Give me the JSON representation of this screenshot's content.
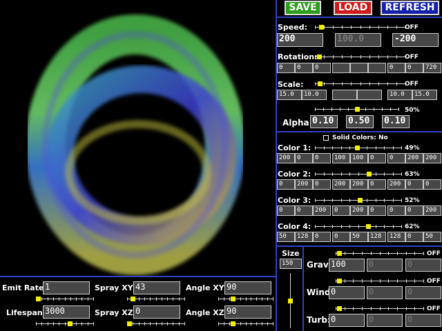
{
  "toolbar": {
    "save_label": "SAVE",
    "load_label": "LOAD",
    "refresh_label": "REFRESH",
    "save_color": "#2a9d1a",
    "load_color": "#cf1a1a",
    "refresh_color": "#1420aa"
  },
  "speed": {
    "label": "Speed:",
    "state": "OFF",
    "level": 0.05,
    "values": [
      "200",
      "100.0",
      "-200"
    ]
  },
  "rotation": {
    "label": "Rotation:",
    "state": "OFF",
    "level": 0.02,
    "values": [
      "0",
      "0",
      "0",
      "",
      "",
      "",
      "0",
      "0",
      "720"
    ]
  },
  "scale": {
    "label": "Scale:",
    "state": "OFF",
    "level": 0.03,
    "values": [
      "15.0",
      "10.0",
      "",
      "",
      "10.0",
      "15.0"
    ]
  },
  "alpha": {
    "label": "Alpha:",
    "percent": "50%",
    "level": 0.5,
    "values": [
      "0.10",
      "0.50",
      "0.10"
    ]
  },
  "solid_colors": {
    "label": "Solid Colors: No"
  },
  "colors": [
    {
      "label": "Color 1:",
      "percent": "49%",
      "level": 0.49,
      "values": [
        "200",
        "0",
        "0",
        "100",
        "100",
        "0",
        "0",
        "200",
        "200"
      ]
    },
    {
      "label": "Color 2:",
      "percent": "63%",
      "level": 0.63,
      "values": [
        "0",
        "200",
        "0",
        "200",
        "200",
        "0",
        "200",
        "0",
        "0"
      ]
    },
    {
      "label": "Color 3:",
      "percent": "52%",
      "level": 0.52,
      "values": [
        "0",
        "0",
        "200",
        "0",
        "200",
        "0",
        "0",
        "0",
        "200"
      ]
    },
    {
      "label": "Color 4:",
      "percent": "62%",
      "level": 0.62,
      "values": [
        "50",
        "128",
        "0",
        "0",
        "50",
        "128",
        "128",
        "0",
        "50"
      ]
    }
  ],
  "emitter": {
    "emit_rate": {
      "label": "Emit Rate:",
      "value": "1",
      "level": 0.0
    },
    "spray_xy": {
      "label": "Spray XY:",
      "value": "43",
      "level": 0.06
    },
    "angle_xy": {
      "label": "Angle XY:",
      "value": "90",
      "level": 0.25
    },
    "lifespan": {
      "label": "Lifespan:",
      "value": "3000",
      "level": 0.6
    },
    "spray_xz": {
      "label": "Spray XZ:",
      "value": "0",
      "level": 0.0
    },
    "angle_xz": {
      "label": "Angle XZ:",
      "value": "90",
      "level": 0.25
    }
  },
  "size": {
    "label": "Size",
    "value": "150",
    "level": 0.5
  },
  "forces": [
    {
      "label": "Grav:",
      "state": "OFF",
      "level": 0.02,
      "values": [
        "100",
        "0",
        "0"
      ]
    },
    {
      "label": "Wind:",
      "state": "OFF",
      "level": 0.02,
      "values": [
        "0",
        "0",
        "0"
      ]
    },
    {
      "label": "Turb:",
      "state": "OFF",
      "level": 0.02,
      "values": [
        "0",
        "0",
        "0"
      ]
    }
  ]
}
